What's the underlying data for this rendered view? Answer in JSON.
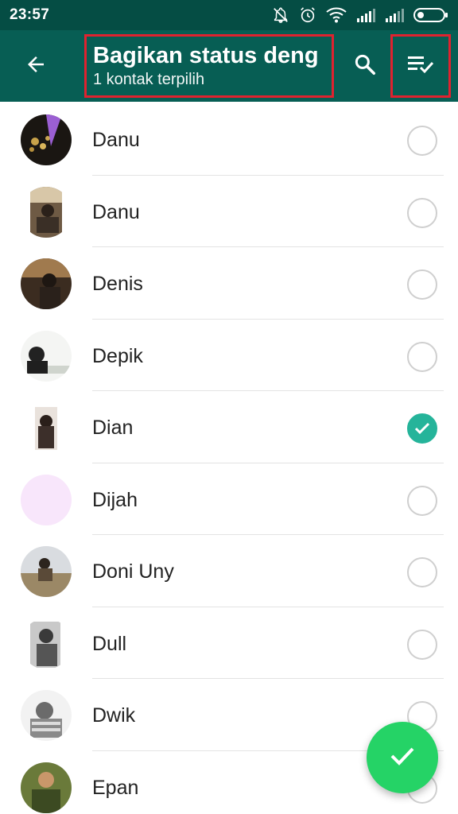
{
  "status_bar": {
    "time": "23:57",
    "icons": [
      "bell-off-icon",
      "alarm-icon",
      "wifi-icon",
      "signal-icon",
      "signal-icon",
      "battery-icon"
    ]
  },
  "header": {
    "title": "Bagikan status deng",
    "subtitle": "1 kontak terpilih",
    "back_icon": "arrow-left-icon",
    "search_icon": "search-icon",
    "select_all_icon": "select-all-icon",
    "highlight_color": "#e0222f"
  },
  "contacts": [
    {
      "name": "Danu",
      "selected": false
    },
    {
      "name": "Danu",
      "selected": false
    },
    {
      "name": "Denis",
      "selected": false
    },
    {
      "name": "Depik",
      "selected": false
    },
    {
      "name": "Dian",
      "selected": true
    },
    {
      "name": "Dijah",
      "selected": false
    },
    {
      "name": "Doni Uny",
      "selected": false
    },
    {
      "name": "Dull",
      "selected": false
    },
    {
      "name": "Dwik",
      "selected": false
    },
    {
      "name": "Epan",
      "selected": false
    }
  ],
  "fab": {
    "icon": "check-icon"
  },
  "colors": {
    "status_bar": "#054d44",
    "app_bar": "#075e54",
    "accent": "#25b49a",
    "fab": "#25d366"
  }
}
